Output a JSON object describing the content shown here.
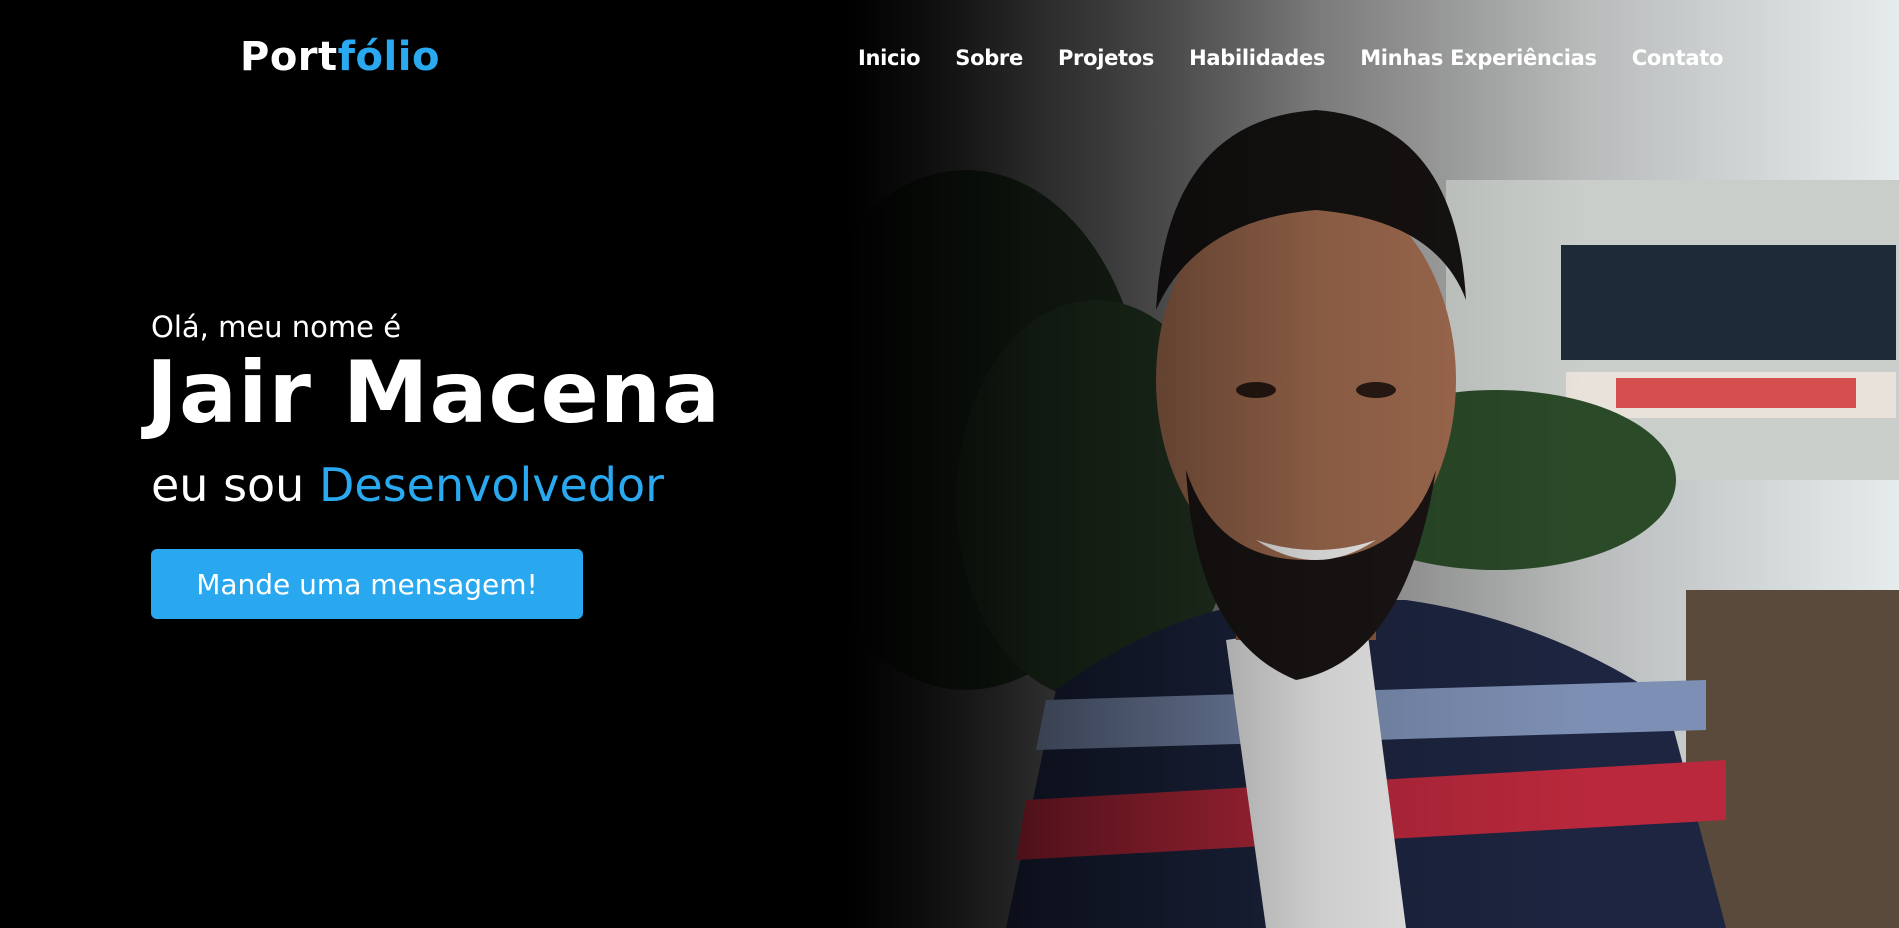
{
  "header": {
    "logo_part1": "Port",
    "logo_part2": "fólio",
    "nav": [
      "Inicio",
      "Sobre",
      "Projetos",
      "Habilidades",
      "Minhas Experiências",
      "Contato"
    ]
  },
  "hero": {
    "greeting": "Olá, meu nome é",
    "name": "Jair Macena",
    "role_prefix": "eu sou ",
    "role": "Desenvolvedor",
    "cta_label": "Mande uma mensagem!"
  },
  "colors": {
    "background": "#000000",
    "accent": "#2aa9f0",
    "button": "#29a8f0",
    "text": "#ffffff"
  }
}
